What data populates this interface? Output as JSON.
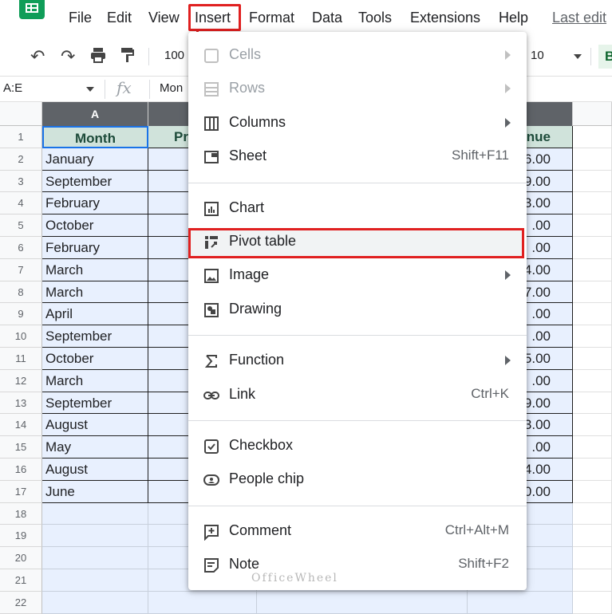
{
  "menubar": {
    "items": [
      "File",
      "Edit",
      "View",
      "Insert",
      "Format",
      "Data",
      "Tools",
      "Extensions",
      "Help"
    ],
    "last_edit": "Last edit"
  },
  "toolbar": {
    "zoom": "100",
    "font_size": "10"
  },
  "formula_bar": {
    "name_box": "A:E",
    "fx": "fx",
    "content": "Mon"
  },
  "grid": {
    "column_a": "A",
    "row_numbers": [
      "1",
      "2",
      "3",
      "4",
      "5",
      "6",
      "7",
      "8",
      "9",
      "10",
      "11",
      "12",
      "13",
      "14",
      "15",
      "16",
      "17",
      "18",
      "19",
      "20",
      "21",
      "22"
    ],
    "header_a": "Month",
    "header_b_partial": "Pr",
    "header_e_partial": "nue",
    "months": [
      "January",
      "September",
      "February",
      "October",
      "February",
      "March",
      "March",
      "April",
      "September",
      "October",
      "March",
      "September",
      "August",
      "May",
      "August",
      "June"
    ],
    "revenue_partial": [
      "6.00",
      "9.00",
      "3.00",
      ".00",
      ".00",
      "4.00",
      "7.00",
      ".00",
      ".00",
      "5.00",
      ".00",
      "9.00",
      "3.00",
      ".00",
      "4.00",
      "0.00"
    ]
  },
  "insert_menu": {
    "groups": [
      [
        {
          "label": "Cells",
          "icon": "cells-icon",
          "submenu": true,
          "disabled": true
        },
        {
          "label": "Rows",
          "icon": "rows-icon",
          "submenu": true,
          "disabled": true
        },
        {
          "label": "Columns",
          "icon": "columns-icon",
          "submenu": true,
          "disabled": false
        },
        {
          "label": "Sheet",
          "icon": "sheet-icon",
          "shortcut": "Shift+F11",
          "disabled": false
        }
      ],
      [
        {
          "label": "Chart",
          "icon": "chart-icon",
          "disabled": false
        },
        {
          "label": "Pivot table",
          "icon": "pivot-table-icon",
          "disabled": false,
          "highlighted": true
        },
        {
          "label": "Image",
          "icon": "image-icon",
          "submenu": true,
          "disabled": false
        },
        {
          "label": "Drawing",
          "icon": "drawing-icon",
          "disabled": false
        }
      ],
      [
        {
          "label": "Function",
          "icon": "sigma-icon",
          "submenu": true,
          "disabled": false
        },
        {
          "label": "Link",
          "icon": "link-icon",
          "shortcut": "Ctrl+K",
          "disabled": false
        }
      ],
      [
        {
          "label": "Checkbox",
          "icon": "checkbox-icon",
          "disabled": false
        },
        {
          "label": "People chip",
          "icon": "people-chip-icon",
          "disabled": false
        }
      ],
      [
        {
          "label": "Comment",
          "icon": "comment-icon",
          "shortcut": "Ctrl+Alt+M",
          "disabled": false
        },
        {
          "label": "Note",
          "icon": "note-icon",
          "shortcut": "Shift+F2",
          "disabled": false
        }
      ]
    ]
  },
  "watermark": "OfficeWheel",
  "colors": {
    "highlight_red": "#e02020",
    "header_fill": "#d0e3db",
    "selection_fill": "#e8f0fe",
    "sheets_green": "#0f9d58"
  }
}
